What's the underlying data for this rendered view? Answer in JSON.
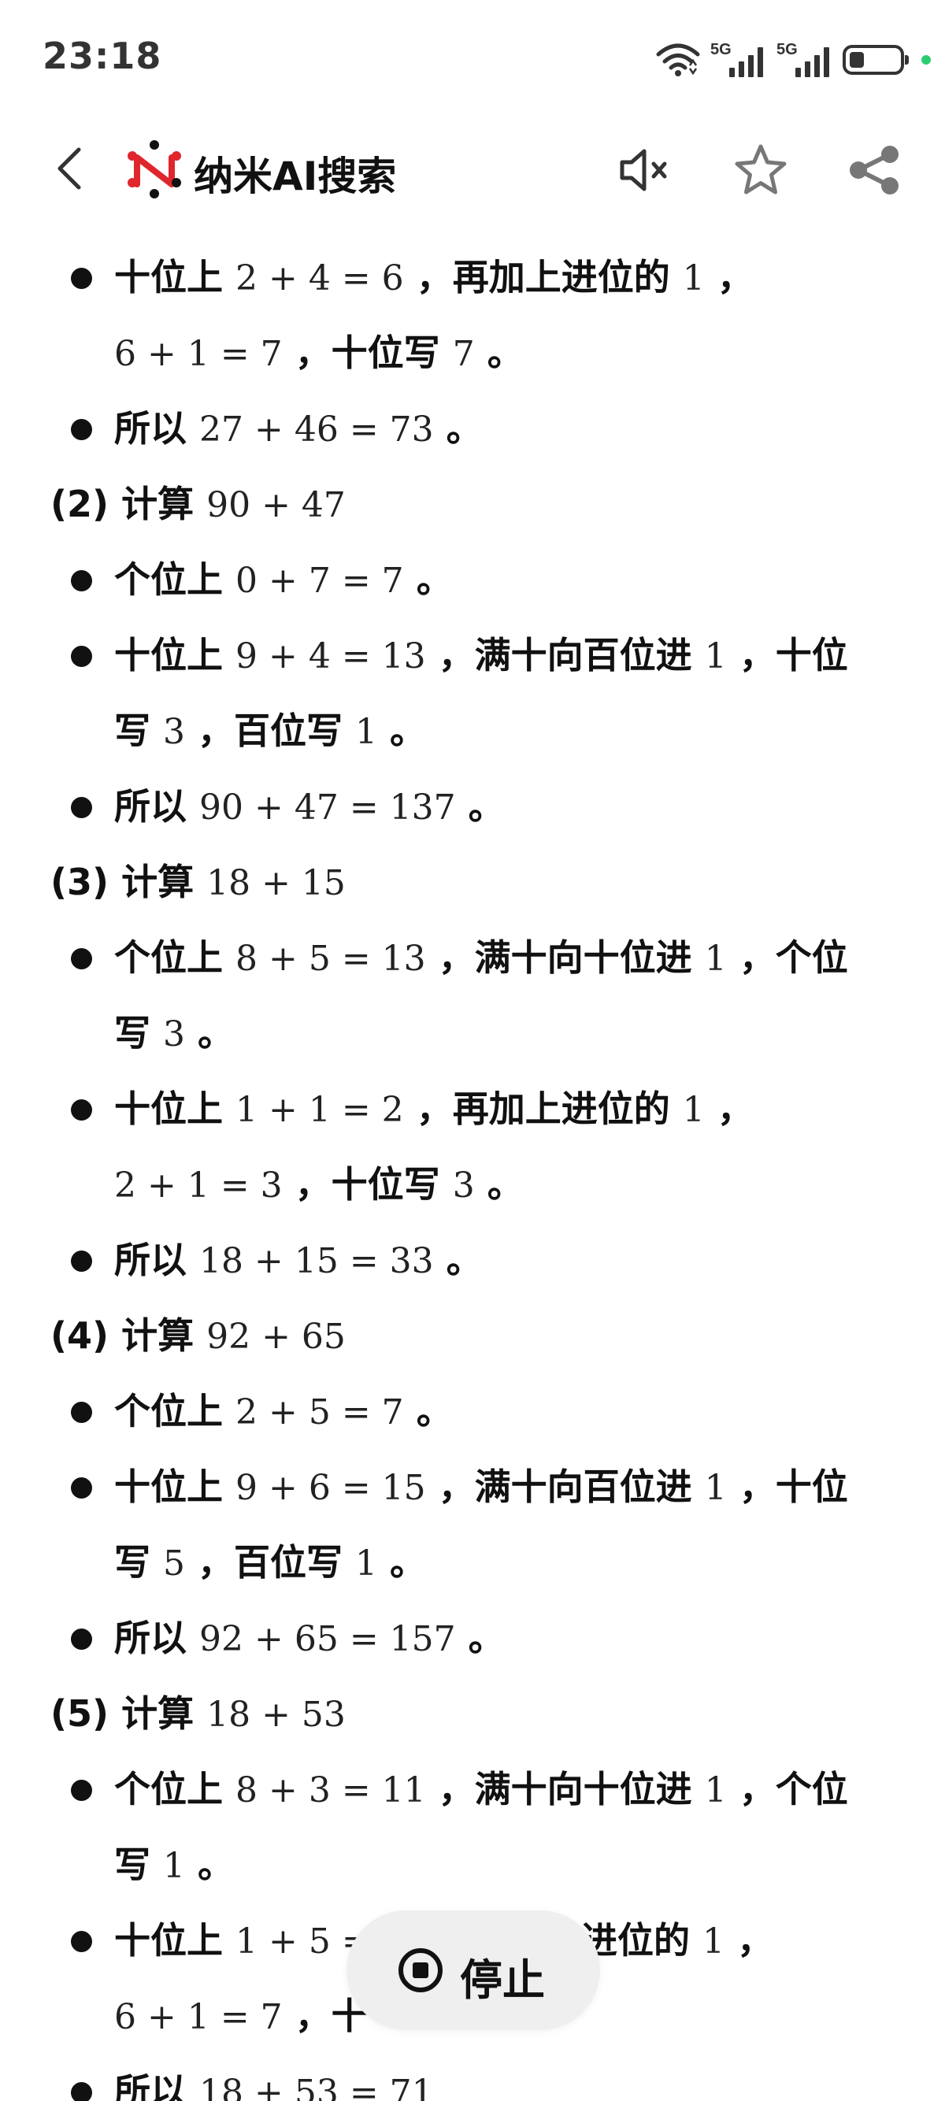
{
  "status_bar": {
    "time": "23:18",
    "network_1": "5G",
    "network_2": "5G"
  },
  "app_bar": {
    "title": "纳米AI搜索"
  },
  "lines": {
    "l1": {
      "a": "十位上 ",
      "m1": "2 + 4 = 6",
      "b": " ，再加上进位的 ",
      "m2": "1",
      "c": " ，"
    },
    "l2": {
      "m1": "6 + 1 = 7",
      "a": " ，十位写 ",
      "m2": "7",
      "b": " 。"
    },
    "l3": {
      "a": "所以 ",
      "m1": "27 + 46 = 73",
      "b": " 。"
    },
    "h2": {
      "num": "(2)",
      "a": " 计算 ",
      "m1": "90 + 47"
    },
    "l4": {
      "a": "个位上 ",
      "m1": "0 + 7 = 7",
      "b": " 。"
    },
    "l5": {
      "a": "十位上 ",
      "m1": "9 + 4 = 13",
      "b": " ，满十向百位进 ",
      "m2": "1",
      "c": " ，十位"
    },
    "l6": {
      "a": "写 ",
      "m1": "3",
      "b": " ，百位写 ",
      "m2": "1",
      "c": " 。"
    },
    "l7": {
      "a": "所以 ",
      "m1": "90 + 47 = 137",
      "b": " 。"
    },
    "h3": {
      "num": "(3)",
      "a": " 计算 ",
      "m1": "18 + 15"
    },
    "l8": {
      "a": "个位上 ",
      "m1": "8 + 5 = 13",
      "b": " ，满十向十位进 ",
      "m2": "1",
      "c": " ，个位"
    },
    "l9": {
      "a": "写 ",
      "m1": "3",
      "b": " 。"
    },
    "l10": {
      "a": "十位上 ",
      "m1": "1 + 1 = 2",
      "b": " ，再加上进位的 ",
      "m2": "1",
      "c": " ，"
    },
    "l11": {
      "m1": "2 + 1 = 3",
      "a": " ，十位写 ",
      "m2": "3",
      "b": " 。"
    },
    "l12": {
      "a": "所以 ",
      "m1": "18 + 15 = 33",
      "b": " 。"
    },
    "h4": {
      "num": "(4)",
      "a": " 计算 ",
      "m1": "92 + 65"
    },
    "l13": {
      "a": "个位上 ",
      "m1": "2 + 5 = 7",
      "b": " 。"
    },
    "l14": {
      "a": "十位上 ",
      "m1": "9 + 6 = 15",
      "b": " ，满十向百位进 ",
      "m2": "1",
      "c": " ，十位"
    },
    "l15": {
      "a": "写 ",
      "m1": "5",
      "b": " ，百位写 ",
      "m2": "1",
      "c": " 。"
    },
    "l16": {
      "a": "所以 ",
      "m1": "92 + 65 = 157",
      "b": " 。"
    },
    "h5": {
      "num": "(5)",
      "a": " 计算 ",
      "m1": "18 + 53"
    },
    "l17": {
      "a": "个位上 ",
      "m1": "8 + 3 = 11",
      "b": " ，满十向十位进 ",
      "m2": "1",
      "c": " ，个位"
    },
    "l18": {
      "a": "写 ",
      "m1": "1",
      "b": " 。"
    },
    "l19": {
      "a": "十位上 ",
      "m1": "1 + 5 =",
      "b": "进位的 ",
      "m2": "1",
      "c": " ，"
    },
    "l20": {
      "m1": "6 + 1 = 7",
      "a": " ，十",
      "b": ""
    },
    "l21": {
      "a": "所以 ",
      "m1": "18 + 53 = 71"
    }
  },
  "stop_button": {
    "label": "停止"
  },
  "icons": {
    "back": "chevron-left-icon",
    "logo": "nami-logo-icon",
    "mute": "speaker-muted-icon",
    "favorite": "star-icon",
    "share": "share-icon",
    "stop": "stop-circle-icon",
    "wifi": "wifi-icon",
    "battery": "battery-icon"
  },
  "colors": {
    "logo_red": "#e0262d",
    "logo_black": "#111111",
    "status_dot": "#2ecc71",
    "pill_bg": "#efefef"
  },
  "battery_level": 0.3
}
